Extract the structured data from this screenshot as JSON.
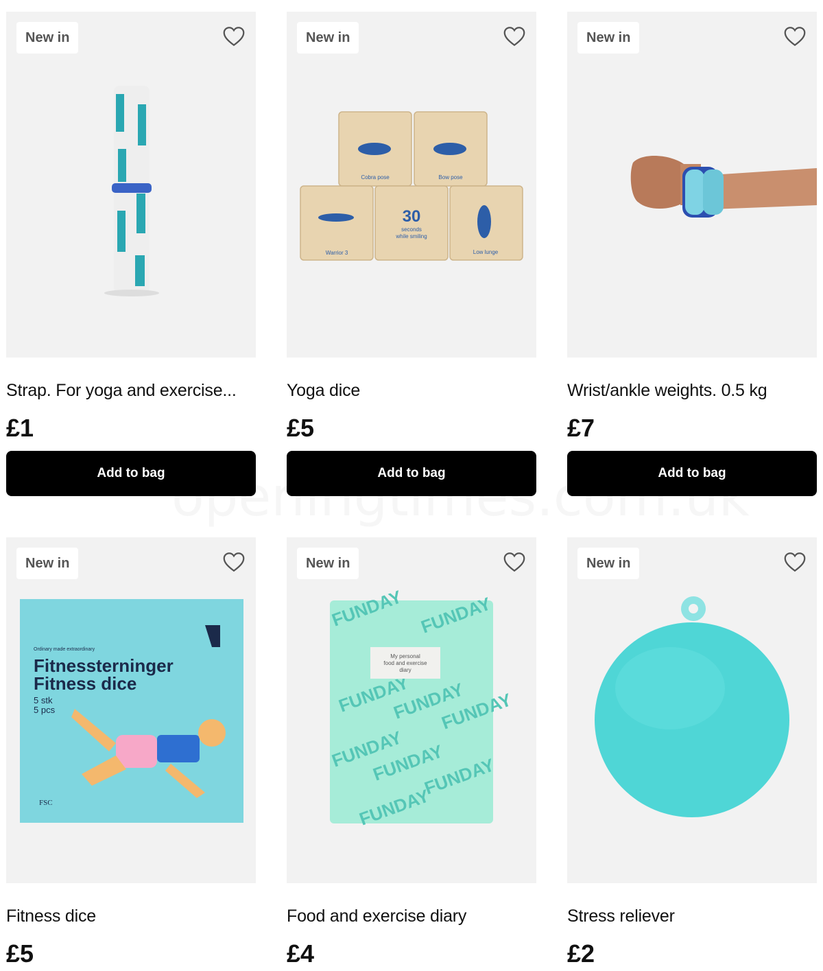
{
  "products": [
    {
      "badge": "New in",
      "title": "Strap. For yoga and exercise...",
      "price": "£1",
      "button": "Add to bag",
      "icon": "heart-outline-icon"
    },
    {
      "badge": "New in",
      "title": "Yoga dice",
      "price": "£5",
      "button": "Add to bag",
      "icon": "heart-outline-icon",
      "image_text": {
        "a": "Cobra pose",
        "b": "Bow pose",
        "c": "Warrior 3",
        "d_num": "30",
        "d1": "seconds",
        "d2": "while smiling",
        "e": "Low lunge"
      }
    },
    {
      "badge": "New in",
      "title": "Wrist/ankle weights. 0.5 kg",
      "price": "£7",
      "button": "Add to bag",
      "icon": "heart-outline-icon"
    },
    {
      "badge": "New in",
      "title": "Fitness dice",
      "price": "£5",
      "icon": "heart-outline-icon",
      "image_text": {
        "tag": "Ordinary made extraordinary",
        "l1": "Fitnessterninger",
        "l2": "Fitness dice",
        "q1": "5 stk",
        "q2": "5 pcs",
        "fsc": "FSC"
      }
    },
    {
      "badge": "New in",
      "title": "Food and exercise diary",
      "price": "£4",
      "icon": "heart-outline-icon",
      "image_text": {
        "l1": "My personal",
        "l2": "food and exercise",
        "l3": "diary",
        "pattern": "FUNDAY"
      }
    },
    {
      "badge": "New in",
      "title": "Stress reliever",
      "price": "£2",
      "icon": "heart-outline-icon"
    }
  ],
  "watermark": "openingtimes.com.uk",
  "colors": {
    "button_bg": "#000000",
    "tile_bg": "#f2f2f2",
    "teal": "#4fd6d6",
    "aqua_box": "#7ed9e0"
  }
}
